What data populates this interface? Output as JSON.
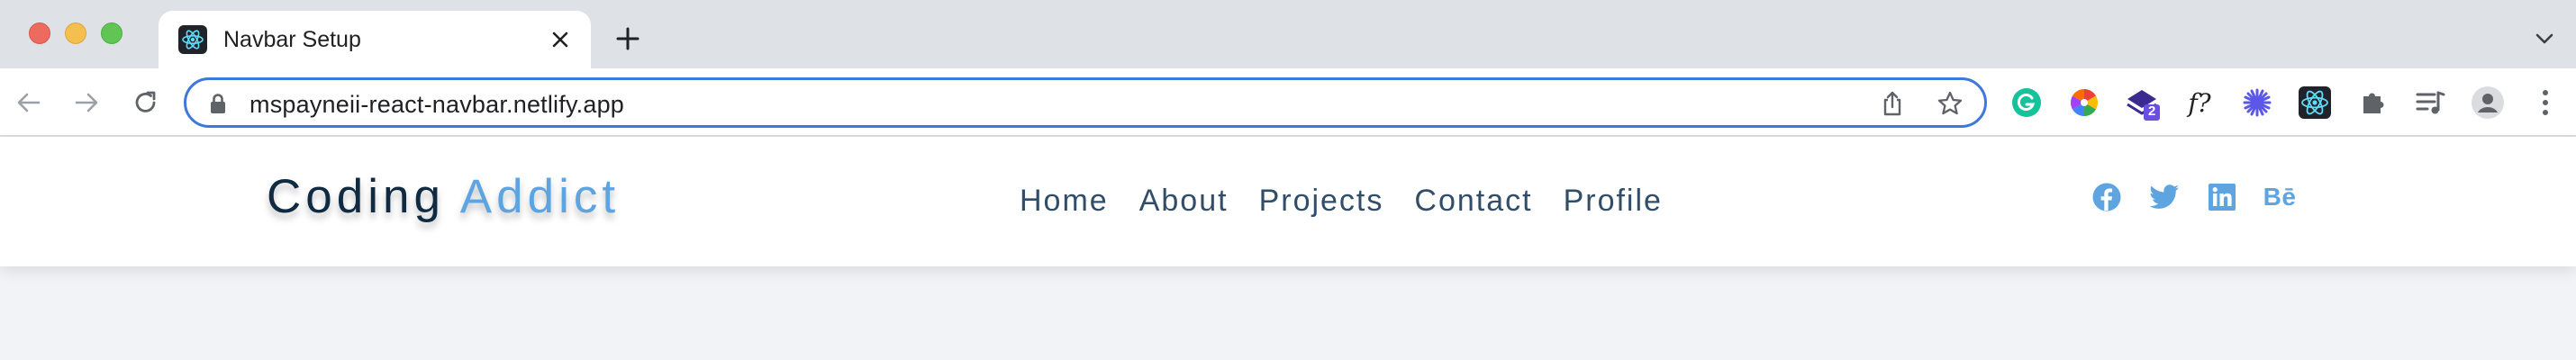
{
  "browser": {
    "tab_title": "Navbar Setup",
    "url": "mspayneii-react-navbar.netlify.app",
    "extension_badge": "2",
    "ext_f_label": "f?"
  },
  "navbar": {
    "logo_primary": "Coding",
    "logo_accent": "Addict",
    "links": [
      "Home",
      "About",
      "Projects",
      "Contact",
      "Profile"
    ],
    "behance_label": "Bē"
  },
  "colors": {
    "accent": "#5ea4e0",
    "nav_text": "#324d67",
    "logo_text": "#102a42",
    "omnibox_border": "#3e78dd"
  }
}
